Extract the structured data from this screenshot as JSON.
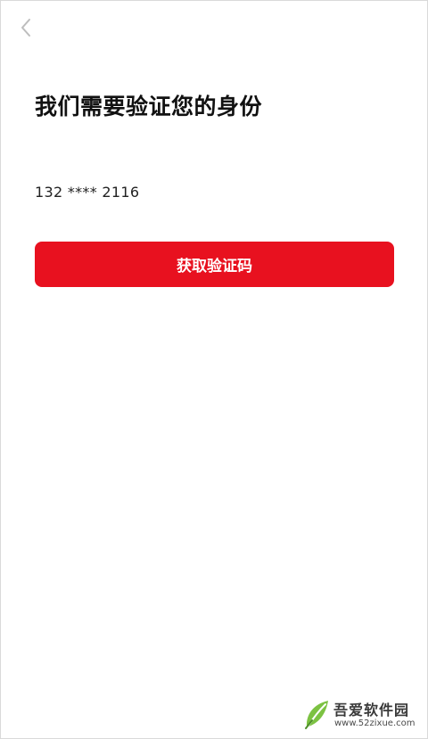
{
  "header": {
    "back_icon": "chevron-left-icon"
  },
  "main": {
    "title": "我们需要验证您的身份",
    "phone_masked": "132 **** 2116",
    "get_code_button": "获取验证码"
  },
  "watermark": {
    "name": "吾爱软件园",
    "url": "www.52zixue.com",
    "logo_icon": "leaf-logo-icon"
  },
  "colors": {
    "accent": "#e8111f",
    "text": "#111111",
    "watermark_green": "#7cc242"
  }
}
